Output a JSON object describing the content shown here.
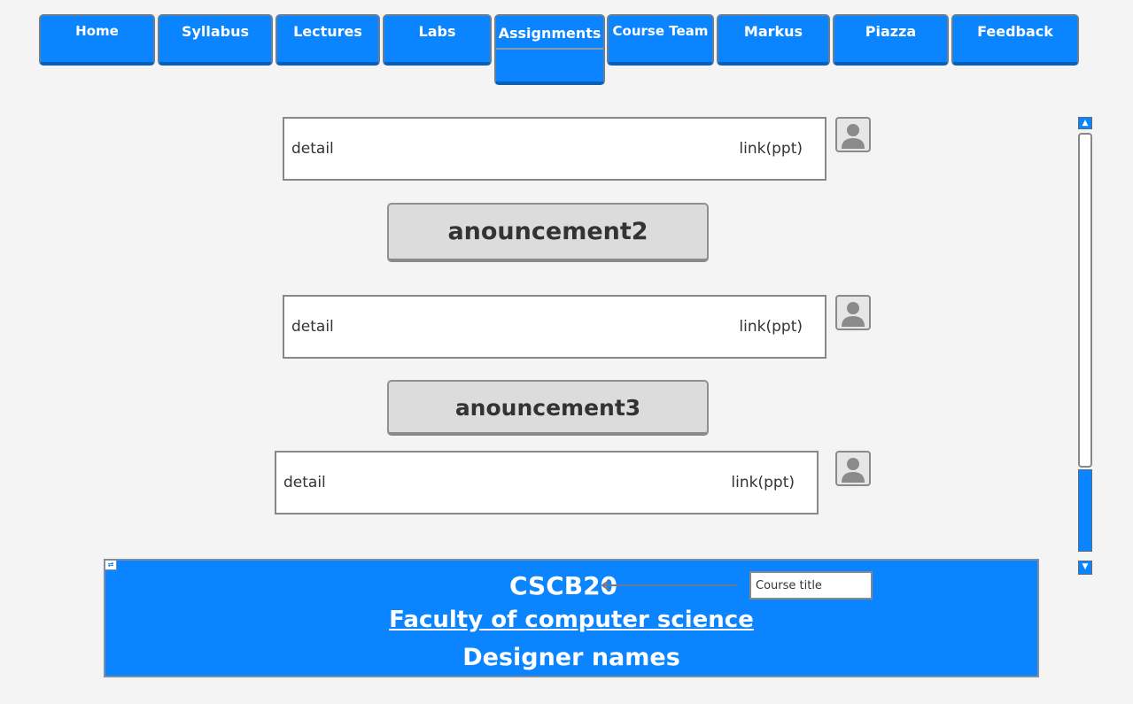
{
  "nav": {
    "home": "Home",
    "syllabus": "Syllabus",
    "lectures": "Lectures",
    "labs": "Labs",
    "assignments": "Assignments",
    "course_team": "Course Team",
    "markus": "Markus",
    "piazza": "Piazza",
    "feedback": "Feedback"
  },
  "announcements": {
    "item1": {
      "detail": "detail",
      "link": "link(ppt)"
    },
    "item2": {
      "title": "anouncement2",
      "detail": "detail",
      "link": "link(ppt)"
    },
    "item3": {
      "title": "anouncement3",
      "detail": "detail",
      "link": "link(ppt)"
    }
  },
  "footer": {
    "course_code": "CSCB20",
    "faculty": "Faculty of computer science",
    "designers": "Designer names",
    "callout_label": "Course title"
  },
  "icons": {
    "avatar": "user-silhouette-icon",
    "scroll_up": "arrow-up-icon",
    "scroll_down": "arrow-down-icon"
  },
  "colors": {
    "accent": "#0a84ff",
    "background": "#f4f4f4",
    "announcement_bar": "#dcdcdc"
  }
}
